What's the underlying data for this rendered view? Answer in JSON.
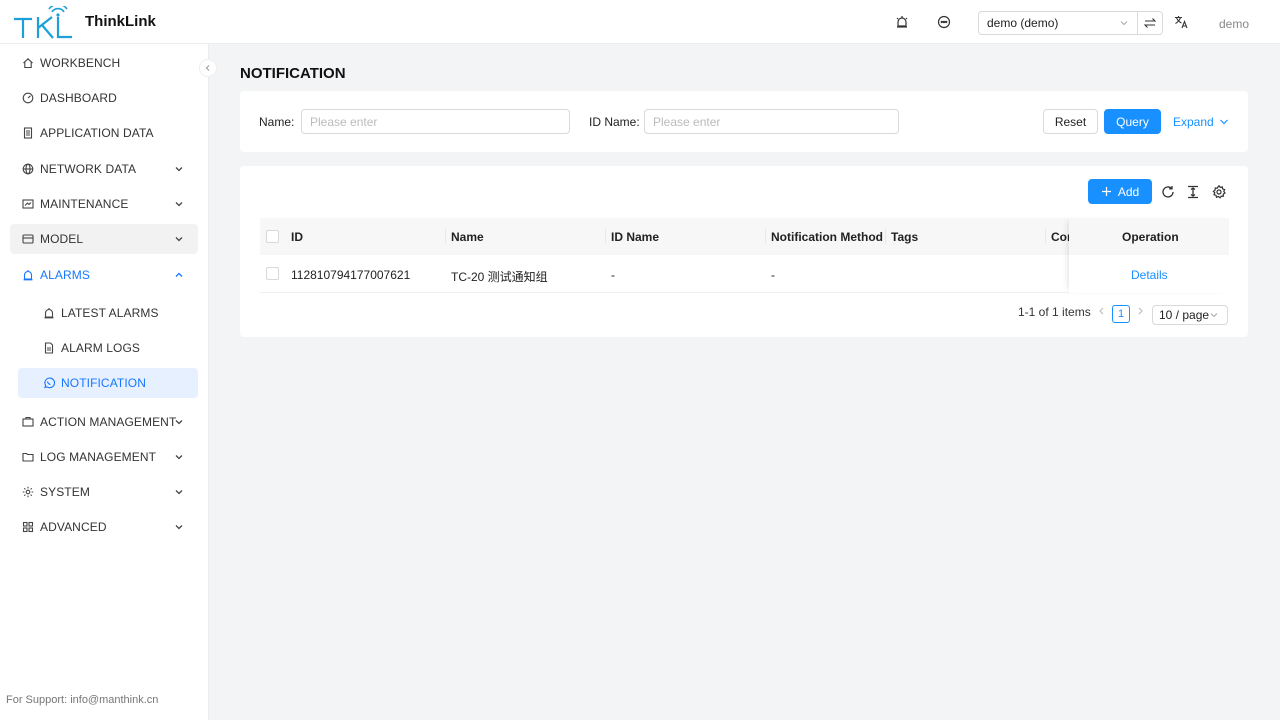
{
  "header": {
    "logo_text": "ThinkLink",
    "tenant_selected": "demo (demo)",
    "user": "demo"
  },
  "sidebar": {
    "items": [
      {
        "label": "WORKBENCH"
      },
      {
        "label": "DASHBOARD"
      },
      {
        "label": "APPLICATION DATA"
      },
      {
        "label": "NETWORK DATA"
      },
      {
        "label": "MAINTENANCE"
      },
      {
        "label": "MODEL"
      },
      {
        "label": "ALARMS"
      },
      {
        "label": "LATEST ALARMS"
      },
      {
        "label": "ALARM LOGS"
      },
      {
        "label": "NOTIFICATION"
      },
      {
        "label": "ACTION MANAGEMENT"
      },
      {
        "label": "LOG MANAGEMENT"
      },
      {
        "label": "SYSTEM"
      },
      {
        "label": "ADVANCED"
      }
    ],
    "support": "For Support: info@manthink.cn"
  },
  "main": {
    "title": "NOTIFICATION",
    "filter": {
      "name_label": "Name",
      "name_placeholder": "Please enter",
      "idname_label": "ID Name",
      "idname_placeholder": "Please enter",
      "reset": "Reset",
      "query": "Query",
      "expand": "Expand"
    },
    "toolbar": {
      "add": "Add"
    },
    "table": {
      "columns": [
        "ID",
        "Name",
        "ID Name",
        "Notification Method",
        "Tags",
        "Cor",
        "Operation"
      ],
      "rows": [
        {
          "id": "112810794177007621",
          "name": "TC-20 测试通知组",
          "id_name": "-",
          "method": "-",
          "tags": "",
          "operation": "Details"
        }
      ]
    },
    "pagination": {
      "summary": "1-1 of 1 items",
      "current_page": "1",
      "page_size": "10 / page"
    }
  },
  "colors": {
    "accent": "#1890ff",
    "selected_bg": "#e6f0ff",
    "logo": "#1ba1d8"
  }
}
